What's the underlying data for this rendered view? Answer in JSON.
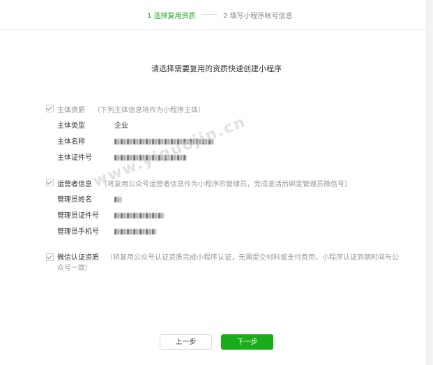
{
  "steps": {
    "step1": "1 选择复用资质",
    "step2": "2 填写小程序帐号信息"
  },
  "title": "请选择需要复用的资质快速创建小程序",
  "subject": {
    "title": "主体资质",
    "desc": "（下列主体信息将作为小程序主体）",
    "rows": [
      {
        "label": "主体类型",
        "value": "企业"
      },
      {
        "label": "主体名称",
        "value": ""
      },
      {
        "label": "主体证件号",
        "value": ""
      }
    ]
  },
  "operator": {
    "title": "运营者信息",
    "desc": "（将复用公众号运营者信息作为小程序的管理员，完成激活后绑定管理员微信号）",
    "rows": [
      {
        "label": "管理员姓名",
        "value": ""
      },
      {
        "label": "管理员证件号",
        "value": ""
      },
      {
        "label": "管理员手机号",
        "value": ""
      }
    ]
  },
  "wechat": {
    "title": "微信认证资质",
    "desc": "（将复用公众号认证资质完成小程序认证，无需提交材料或支付费用，小程序认证到期时间与公众号一致）"
  },
  "buttons": {
    "prev": "上一步",
    "next": "下一步"
  },
  "watermark": "www.yiguojin.cn",
  "colors": {
    "accent": "#1aad19"
  }
}
